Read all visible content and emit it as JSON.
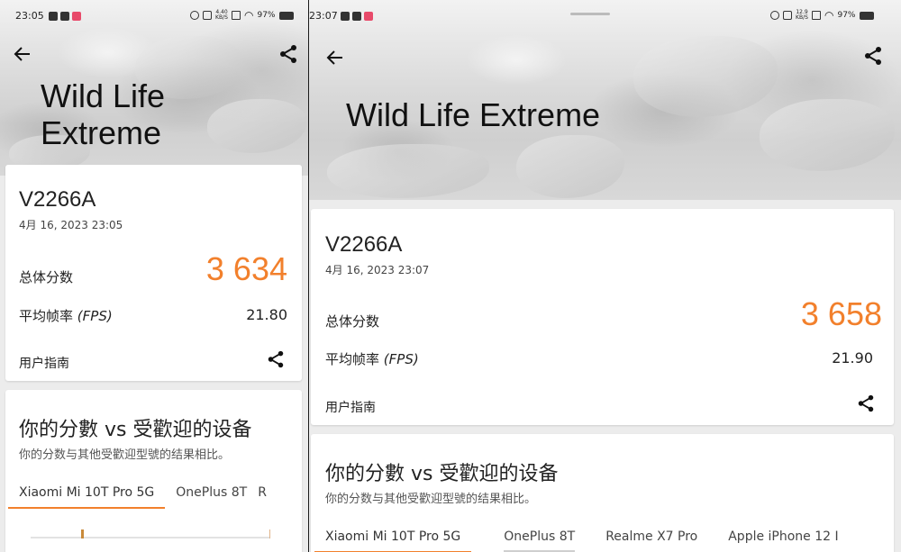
{
  "left": {
    "status": {
      "time": "23:05",
      "speed": "4.40 KB/S",
      "battery": "97%"
    },
    "hero_title": "Wild Life Extreme",
    "result": {
      "device": "V2266A",
      "date": "4月 16, 2023 23:05",
      "score_label": "总体分数",
      "score": "3 634",
      "fps_label": "平均帧率",
      "fps_unit": "(FPS)",
      "fps": "21.80",
      "guide": "用户指南"
    },
    "compare": {
      "title": "你的分數 vs 受歡迎的设备",
      "subtitle": "你的分数与其他受歡迎型號的结果相比。",
      "tabs": [
        "Xiaomi Mi 10T Pro 5G",
        "OnePlus 8T",
        "R"
      ]
    }
  },
  "right": {
    "status": {
      "time": "23:07",
      "speed": "12.9 KB/S",
      "battery": "97%"
    },
    "hero_title": "Wild Life Extreme",
    "result": {
      "device": "V2266A",
      "date": "4月 16, 2023 23:07",
      "score_label": "总体分数",
      "score": "3 658",
      "fps_label": "平均帧率",
      "fps_unit": "(FPS)",
      "fps": "21.90",
      "guide": "用户指南"
    },
    "compare": {
      "title": "你的分數 vs 受歡迎的设备",
      "subtitle": "你的分数与其他受歡迎型號的结果相比。",
      "tabs": [
        "Xiaomi Mi 10T Pro 5G",
        "OnePlus 8T",
        "Realme X7 Pro",
        "Apple iPhone 12 I"
      ]
    }
  },
  "colors": {
    "accent": "#f2802c",
    "card": "#ffffff",
    "text": "#222222"
  },
  "icons": [
    "back-arrow-icon",
    "share-icon",
    "wifi-icon",
    "battery-icon",
    "alarm-icon",
    "vibrate-icon"
  ]
}
